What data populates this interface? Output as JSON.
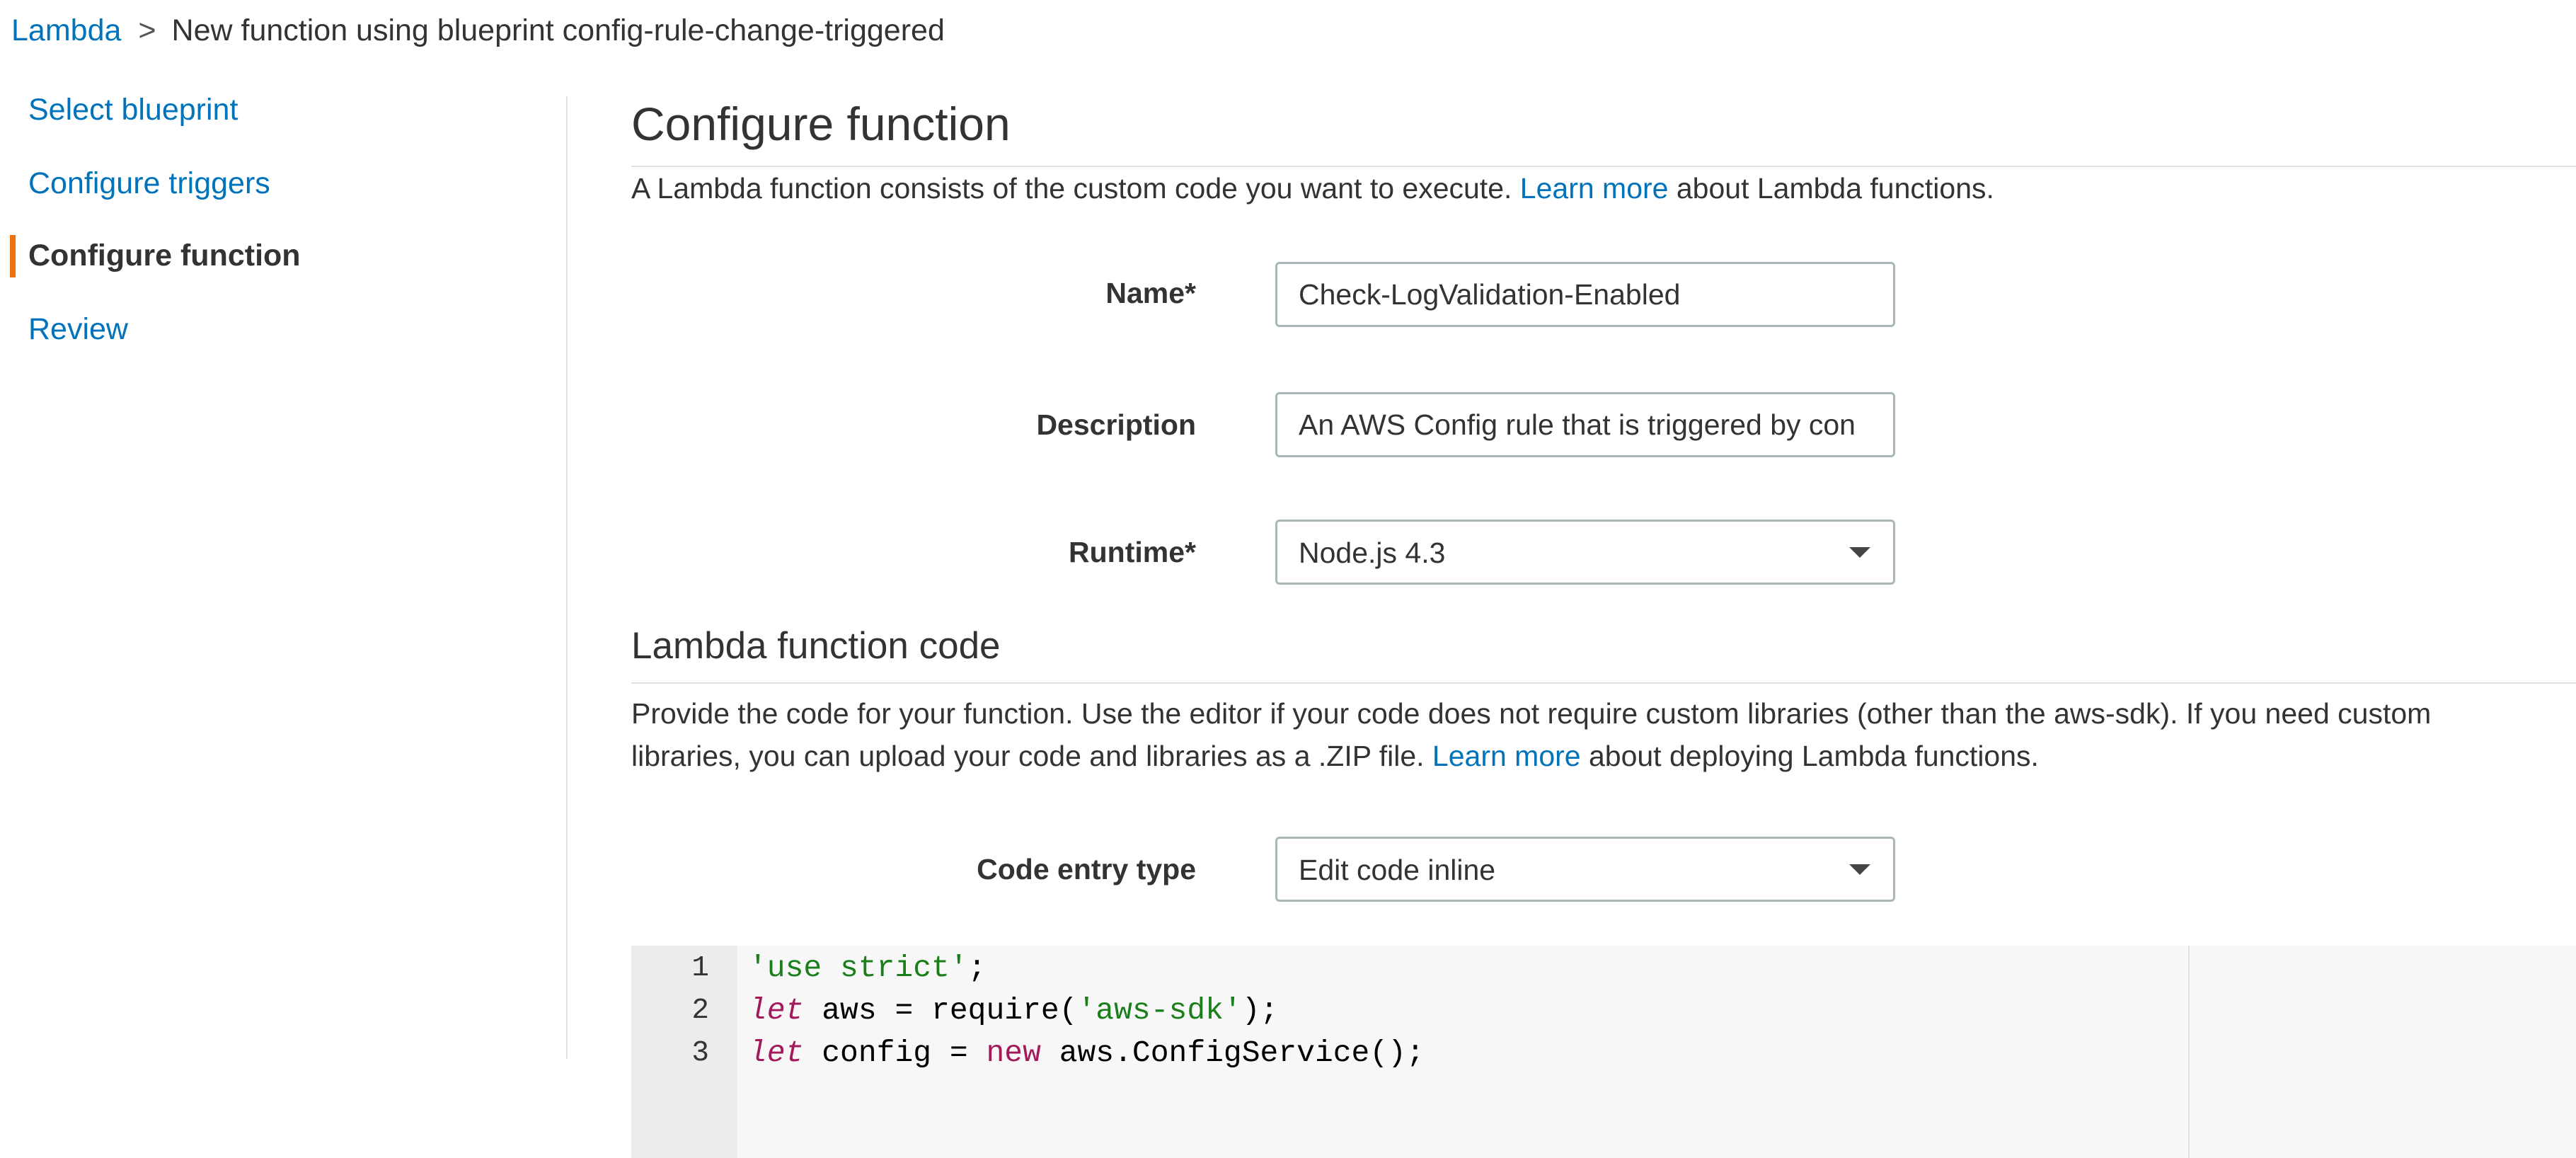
{
  "breadcrumb": {
    "root": "Lambda",
    "separator": ">",
    "current": "New function using blueprint config-rule-change-triggered"
  },
  "sidebar": {
    "items": [
      {
        "label": "Select blueprint",
        "active": false
      },
      {
        "label": "Configure triggers",
        "active": false
      },
      {
        "label": "Configure function",
        "active": true
      },
      {
        "label": "Review",
        "active": false
      }
    ]
  },
  "configure": {
    "title": "Configure function",
    "intro_prefix": "A Lambda function consists of the custom code you want to execute. ",
    "intro_link": "Learn more",
    "intro_suffix": " about Lambda functions.",
    "name_label": "Name*",
    "name_value": "Check-LogValidation-Enabled",
    "description_label": "Description",
    "description_value": "An AWS Config rule that is triggered by con",
    "runtime_label": "Runtime*",
    "runtime_value": "Node.js 4.3"
  },
  "code_section": {
    "title": "Lambda function code",
    "line1": "Provide the code for your function. Use the editor if your code does not require custom libraries (other than the aws-sdk). If you need custom",
    "line2_prefix": "libraries, you can upload your code and libraries as a .ZIP file. ",
    "line2_link": "Learn more",
    "line2_suffix": " about deploying Lambda functions.",
    "entry_type_label": "Code entry type",
    "entry_type_value": "Edit code inline"
  },
  "editor": {
    "line_numbers": [
      "1",
      "2",
      "3"
    ],
    "lines": [
      {
        "s1": "'use strict'",
        "t1": ";"
      },
      {
        "kw": "let",
        "t1": " aws = require(",
        "s1": "'aws-sdk'",
        "t2": ");"
      },
      {
        "kw": "let",
        "t1": " config = ",
        "kw2": "new",
        "t2": " aws.ConfigService();"
      }
    ]
  },
  "colors": {
    "link": "#0073bb",
    "active_marker": "#ec7211",
    "string": "#1a7e1a",
    "keyword": "#a31a5a"
  }
}
